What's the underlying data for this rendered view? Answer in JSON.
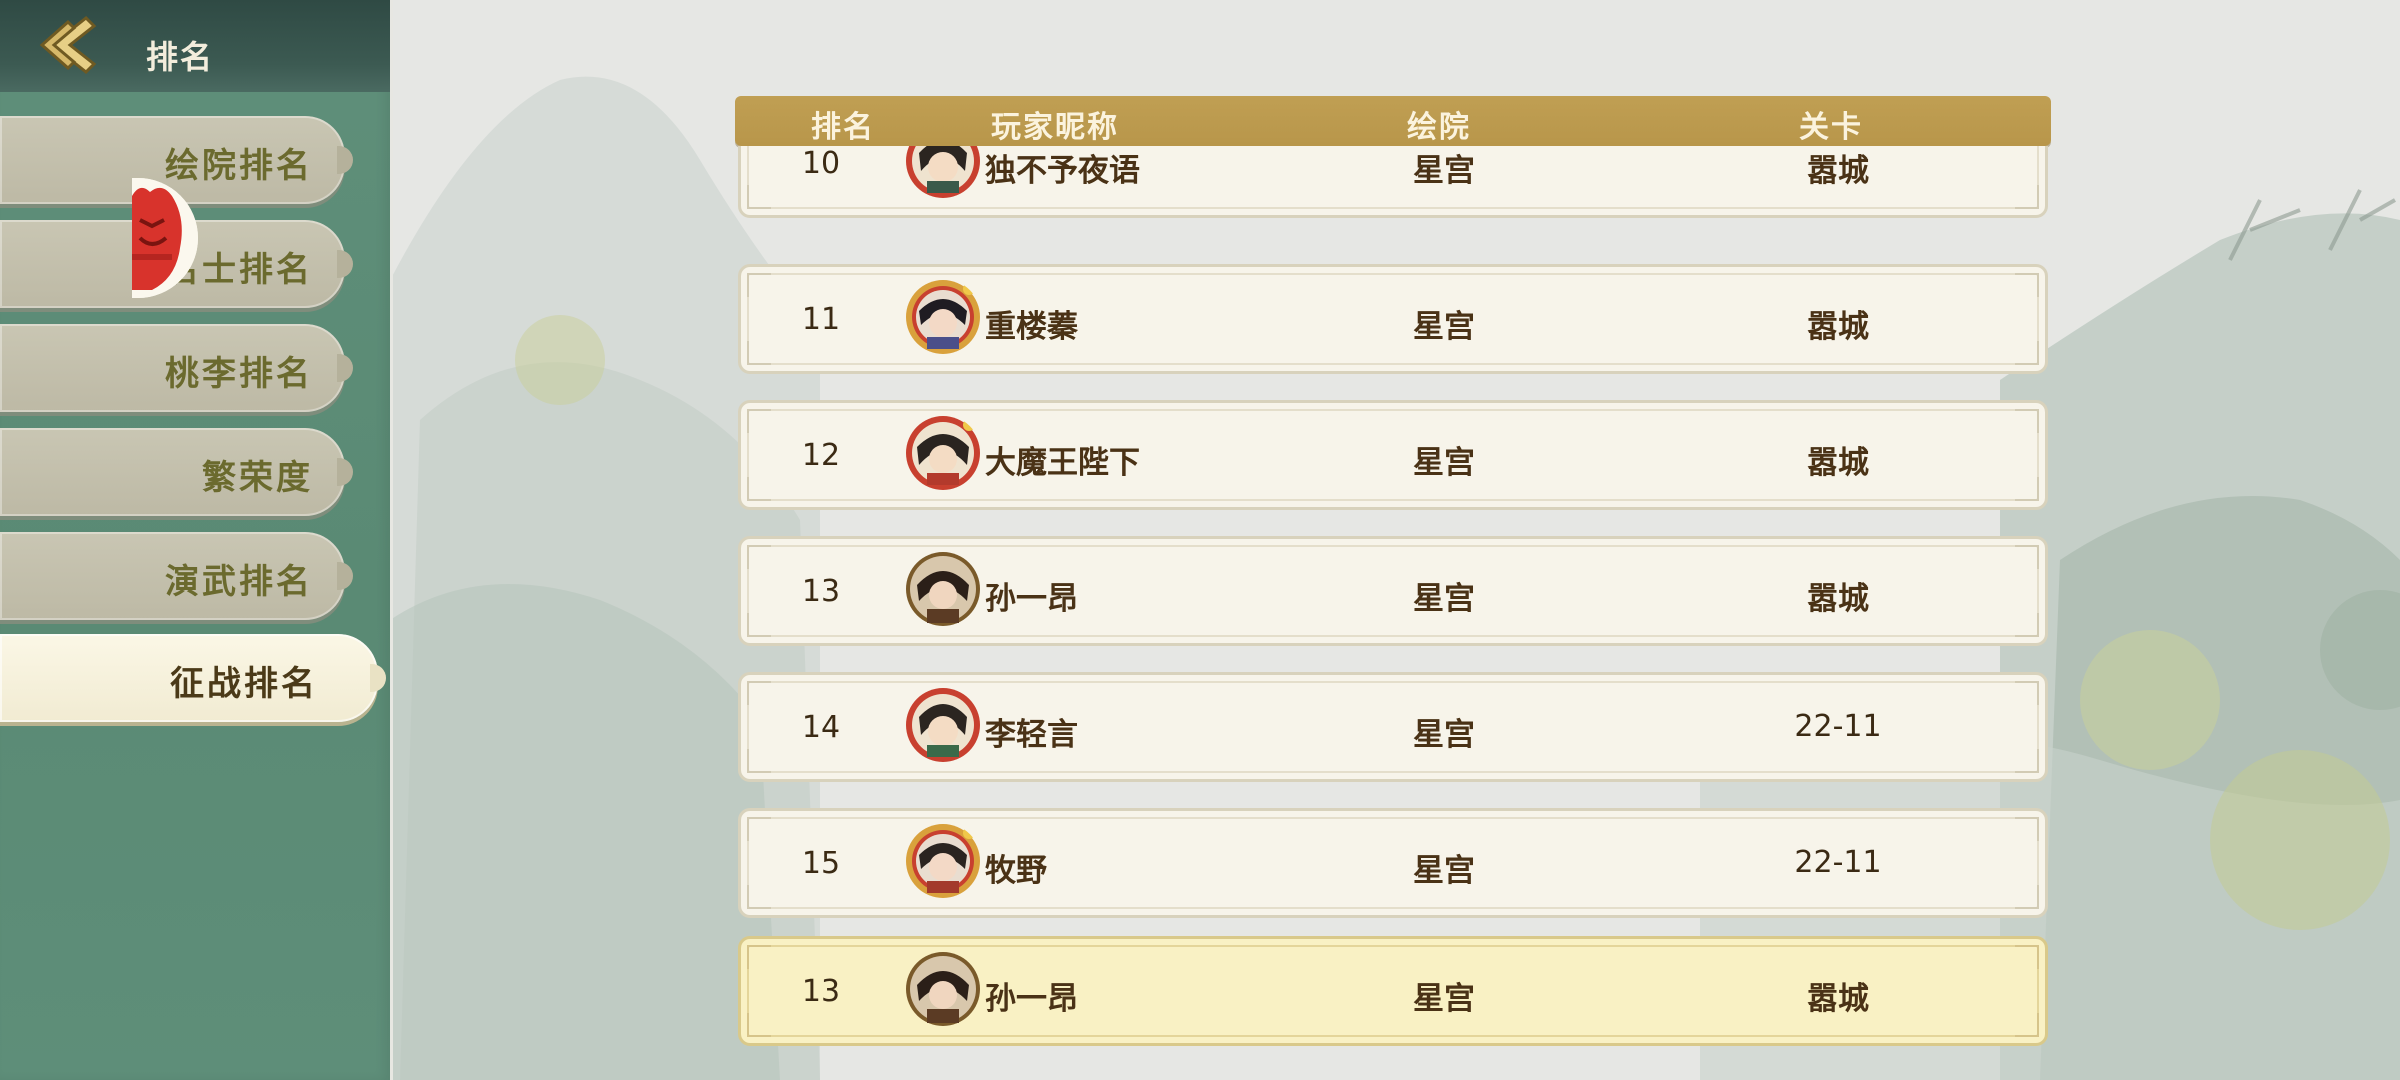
{
  "header": {
    "title": "排名"
  },
  "sidebar": {
    "items": [
      {
        "label": "绘院排名",
        "active": false
      },
      {
        "label": "名士排名",
        "active": false
      },
      {
        "label": "桃李排名",
        "active": false
      },
      {
        "label": "繁荣度",
        "active": false
      },
      {
        "label": "演武排名",
        "active": false
      },
      {
        "label": "征战排名",
        "active": true
      }
    ]
  },
  "table": {
    "columns": [
      "排名",
      "玩家昵称",
      "绘院",
      "关卡"
    ],
    "rows": [
      {
        "rank": "10",
        "name": "独不予夜语",
        "academy": "星宫",
        "stage": "嚣城",
        "avatar_frame": "red"
      },
      {
        "rank": "11",
        "name": "重楼蓁",
        "academy": "星宫",
        "stage": "嚣城",
        "avatar_frame": "gold-red"
      },
      {
        "rank": "12",
        "name": "大魔王陛下",
        "academy": "星宫",
        "stage": "嚣城",
        "avatar_frame": "red"
      },
      {
        "rank": "13",
        "name": "孙一昂",
        "academy": "星宫",
        "stage": "嚣城",
        "avatar_frame": "plain"
      },
      {
        "rank": "14",
        "name": "李轻言",
        "academy": "星宫",
        "stage": "22-11",
        "avatar_frame": "red"
      },
      {
        "rank": "15",
        "name": "牧野",
        "academy": "星宫",
        "stage": "22-11",
        "avatar_frame": "gold-red"
      }
    ],
    "my_row": {
      "rank": "13",
      "name": "孙一昂",
      "academy": "星宫",
      "stage": "嚣城",
      "avatar_frame": "plain"
    }
  },
  "colors": {
    "sidebar_green": "#5f8f7a",
    "header_gold": "#c09f53",
    "row_bg": "#f7f4ea",
    "my_row_bg": "#f9f1c4",
    "text_brown": "#4a3216"
  }
}
